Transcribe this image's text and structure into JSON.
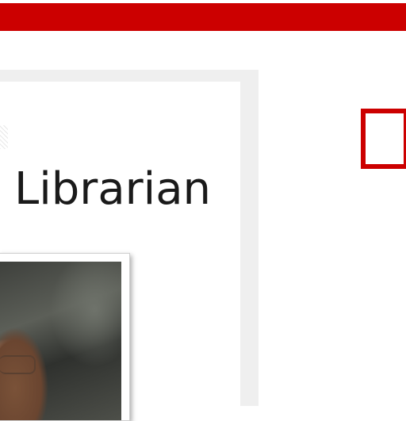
{
  "header": {
    "accent_color": "#cc0000"
  },
  "profile": {
    "title": "Librarian",
    "photo": "staff-portrait-photo"
  },
  "decor": {
    "frame_color": "#cc0000"
  }
}
